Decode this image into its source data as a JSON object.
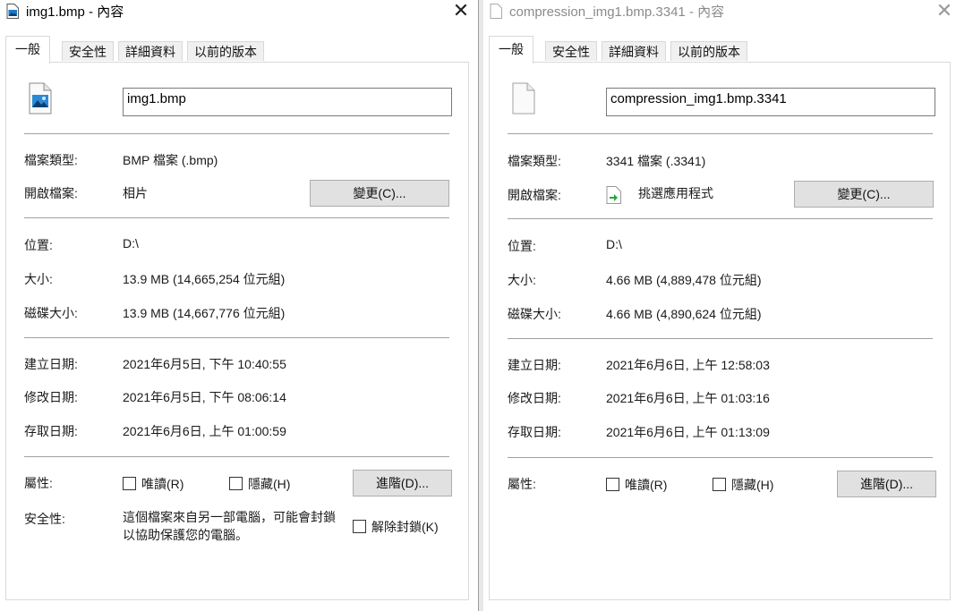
{
  "left": {
    "title": "img1.bmp - 內容",
    "close": "✕",
    "tabs": [
      "一般",
      "安全性",
      "詳細資料",
      "以前的版本"
    ],
    "filename": "img1.bmp",
    "type_label": "檔案類型:",
    "type_value": "BMP 檔案 (.bmp)",
    "open_label": "開啟檔案:",
    "open_value": "相片",
    "change_btn": "變更(C)...",
    "location_label": "位置:",
    "location_value": "D:\\",
    "size_label": "大小:",
    "size_value": "13.9 MB (14,665,254 位元組)",
    "disk_label": "磁碟大小:",
    "disk_value": "13.9 MB (14,667,776 位元組)",
    "created_label": "建立日期:",
    "created_value": "2021年6月5日, 下午 10:40:55",
    "modified_label": "修改日期:",
    "modified_value": "2021年6月5日, 下午 08:06:14",
    "accessed_label": "存取日期:",
    "accessed_value": "2021年6月6日, 上午 01:00:59",
    "attr_label": "屬性:",
    "readonly_label": "唯讀(R)",
    "hidden_label": "隱藏(H)",
    "advanced_btn": "進階(D)...",
    "security_label": "安全性:",
    "security_text": "這個檔案來自另一部電腦，可能會封鎖以協助保護您的電腦。",
    "unblock_label": "解除封鎖(K)"
  },
  "right": {
    "title": "compression_img1.bmp.3341 - 內容",
    "close": "✕",
    "tabs": [
      "一般",
      "安全性",
      "詳細資料",
      "以前的版本"
    ],
    "filename": "compression_img1.bmp.3341",
    "type_label": "檔案類型:",
    "type_value": "3341 檔案 (.3341)",
    "open_label": "開啟檔案:",
    "open_value": "挑選應用程式",
    "change_btn": "變更(C)...",
    "location_label": "位置:",
    "location_value": "D:\\",
    "size_label": "大小:",
    "size_value": "4.66 MB (4,889,478 位元組)",
    "disk_label": "磁碟大小:",
    "disk_value": "4.66 MB (4,890,624 位元組)",
    "created_label": "建立日期:",
    "created_value": "2021年6月6日, 上午 12:58:03",
    "modified_label": "修改日期:",
    "modified_value": "2021年6月6日, 上午 01:03:16",
    "accessed_label": "存取日期:",
    "accessed_value": "2021年6月6日, 上午 01:13:09",
    "attr_label": "屬性:",
    "readonly_label": "唯讀(R)",
    "hidden_label": "隱藏(H)",
    "advanced_btn": "進階(D)..."
  },
  "colors": {
    "accent": "#0078d7",
    "button_bg": "#e1e1e1",
    "separator": "#a0a0a0",
    "inactive_title": "#8a8a8a"
  },
  "icons": {
    "left_title": "bitmap-image-icon",
    "right_title": "generic-file-icon",
    "open_with": "pick-app-icon"
  }
}
